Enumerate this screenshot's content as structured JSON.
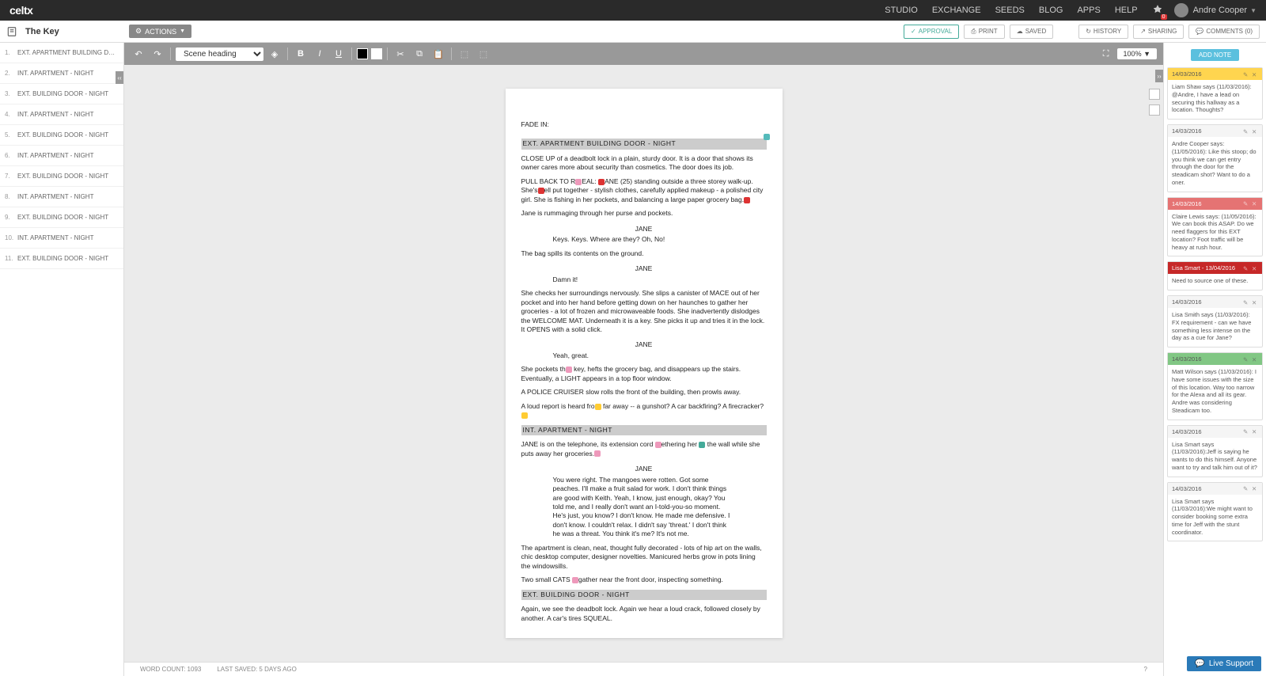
{
  "topbar": {
    "logo": "celtx",
    "nav": [
      "STUDIO",
      "EXCHANGE",
      "SEEDS",
      "BLOG",
      "APPS",
      "HELP"
    ],
    "notif_count": "0",
    "username": "Andre Cooper"
  },
  "titlebar": {
    "doc_title": "The Key",
    "actions_label": "ACTIONS",
    "buttons": {
      "approval": "APPROVAL",
      "print": "PRINT",
      "saved": "SAVED",
      "history": "HISTORY",
      "sharing": "SHARING",
      "comments": "COMMENTS (0)"
    }
  },
  "toolbar": {
    "style_select": "Scene heading",
    "zoom": "100%"
  },
  "scenes": [
    {
      "n": "1.",
      "label": "EXT. APARTMENT BUILDING DOO…"
    },
    {
      "n": "2.",
      "label": "INT. APARTMENT - NIGHT"
    },
    {
      "n": "3.",
      "label": "EXT. BUILDING DOOR - NIGHT"
    },
    {
      "n": "4.",
      "label": "INT. APARTMENT - NIGHT"
    },
    {
      "n": "5.",
      "label": "EXT. BUILDING DOOR - NIGHT"
    },
    {
      "n": "6.",
      "label": "INT. APARTMENT - NIGHT"
    },
    {
      "n": "7.",
      "label": "EXT. BUILDING DOOR - NIGHT"
    },
    {
      "n": "8.",
      "label": "INT. APARTMENT - NIGHT"
    },
    {
      "n": "9.",
      "label": "EXT. BUILDING DOOR - NIGHT"
    },
    {
      "n": "10.",
      "label": "INT. APARTMENT - NIGHT"
    },
    {
      "n": "11.",
      "label": "EXT. BUILDING DOOR - NIGHT"
    }
  ],
  "script": {
    "fade_in": "FADE IN:",
    "sh1": "EXT. APARTMENT BUILDING DOOR - NIGHT",
    "a1": "CLOSE UP of a deadbolt lock in a plain, sturdy door. It is a door that shows its owner cares more about security than cosmetics. The door does its job.",
    "a2": "PULL BACK TO REVEAL: JANE (25) standing outside a three storey walk-up. She's well put together - stylish clothes, carefully applied makeup - a polished city girl. She is fishing in her pockets, and balancing a large paper grocery bag.",
    "a3": "Jane is rummaging through her purse and pockets.",
    "c1": "JANE",
    "d1": "Keys. Keys. Where are they? Oh, No!",
    "a4": "The bag spills its contents on the ground.",
    "c2": "JANE",
    "d2": "Damn it!",
    "a5": "She checks her surroundings nervously. She slips a canister of MACE out of her pocket and into her hand before getting down on her haunches to gather her groceries - a lot of frozen and microwaveable foods. She inadvertently dislodges the WELCOME MAT. Underneath it is a key. She picks it up and tries it in the lock. It OPENS with a solid click.",
    "c3": "JANE",
    "d3": "Yeah, great.",
    "a6": "She pockets the key, hefts the grocery bag, and disappears up the stairs. Eventually, a LIGHT appears in a top floor window.",
    "a7": "A POLICE CRUISER slow rolls the front of the building, then prowls away.",
    "a8": "A loud report is heard from far away -- a gunshot? A car backfiring? A firecracker?",
    "sh2": "INT. APARTMENT - NIGHT",
    "a9": "JANE is on the telephone, its extension cord tethering her to the wall while she puts away her groceries.",
    "c4": "JANE",
    "d4": "You were right. The mangoes were rotten. Got some peaches. I'll make a fruit salad for work. I don't think things are good with Keith. Yeah, I know, just enough, okay? You told me, and I really don't want an I-told-you-so moment. He's just, you know? I don't know. He made me defensive. I don't know. I couldn't relax. I didn't say 'threat.' I don't think he was a threat. You think it's me? It's not me.",
    "a10": "The apartment is clean, neat, thought fully decorated - lots of hip art on the walls, chic desktop computer, designer novelties. Manicured herbs grow in pots lining the windowsills.",
    "a11": "Two small CATS gather near the front door, inspecting something.",
    "sh3": "EXT. BUILDING DOOR - NIGHT",
    "a12": "Again, we see the deadbolt lock. Again we hear a loud crack, followed closely by another. A car's tires SQUEAL."
  },
  "status": {
    "word_count": "WORD COUNT: 1093",
    "last_saved": "LAST SAVED: 5 DAYS AGO",
    "page_indicator": "?"
  },
  "notes_panel": {
    "add_note": "ADD NOTE",
    "notes": [
      {
        "cls": "yellow",
        "date": "14/03/2016",
        "body": "Liam Shaw says (11/03/2016): @Andre, I have a lead on securing this hallway as a location. Thoughts?"
      },
      {
        "cls": "plain",
        "date": "14/03/2016",
        "body": "Andre Cooper says: (11/05/2016): Like this stoop; do you think we can get entry through the door for the steadicam shot? Want to do a oner."
      },
      {
        "cls": "red",
        "date": "14/03/2016",
        "body": "Claire Lewis says: (11/05/2016): We can book this ASAP. Do we need flaggers for this EXT location? Foot traffic will be heavy at rush hour."
      },
      {
        "cls": "red-dark",
        "date": "Lisa Smart - 13/04/2016",
        "body": "Need to source one of these."
      },
      {
        "cls": "plain",
        "date": "14/03/2016",
        "body": "Lisa Smith says (11/03/2016): FX requirement - can we have something less intense on the day as a cue for Jane?"
      },
      {
        "cls": "green",
        "date": "14/03/2016",
        "body": "Matt Wilson says (11/03/2016): I have some issues with the size of this location. Way too narrow for the Alexa and all its gear. Andre was considering Steadicam too."
      },
      {
        "cls": "plain",
        "date": "14/03/2016",
        "body": "Lisa Smart says (11/03/2016):Jeff is saying he wants to do this himself. Anyone want to try and talk him out of it?"
      },
      {
        "cls": "plain",
        "date": "14/03/2016",
        "body": "Lisa Smart says (11/03/2016):We might want to consider booking some extra time for Jeff with the stunt coordinator."
      }
    ]
  },
  "live_support": "Live Support"
}
